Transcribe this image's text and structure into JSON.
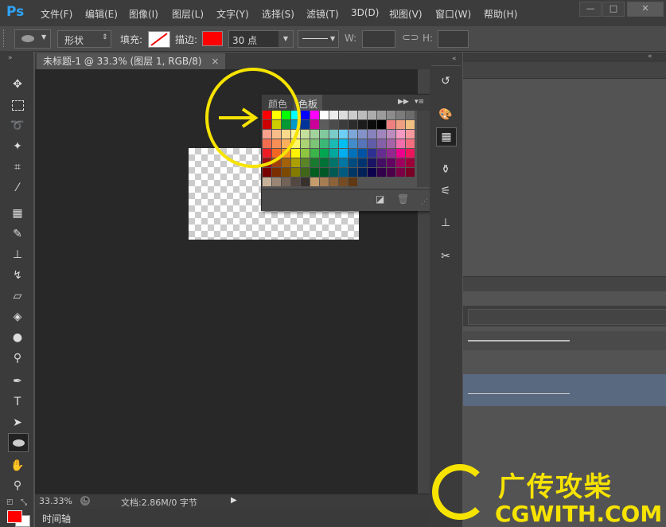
{
  "app": {
    "logo": "Ps"
  },
  "menu": [
    "文件(F)",
    "编辑(E)",
    "图像(I)",
    "图层(L)",
    "文字(Y)",
    "选择(S)",
    "滤镜(T)",
    "3D(D)",
    "视图(V)",
    "窗口(W)",
    "帮助(H)"
  ],
  "window_controls": {
    "minimize": "—",
    "restore": "□",
    "close": "✕"
  },
  "options": {
    "shape_mode": "形状",
    "fill_label": "填充:",
    "stroke_label": "描边:",
    "stroke_color": "#ff0000",
    "stroke_width": "30 点",
    "w_label": "W:",
    "h_label": "H:"
  },
  "document": {
    "tab_title": "未标题-1 @ 33.3% (图层 1, RGB/8)",
    "tab_close": "×",
    "zoom": "33.33%",
    "doc_info": "文档:2.86M/0 字节",
    "timeline_label": "时间轴"
  },
  "swatches_panel": {
    "tab_color": "颜色",
    "tab_swatches": "色板",
    "rows": [
      [
        "#ff0000",
        "#ffff00",
        "#00ff00",
        "#00ffff",
        "#0000ff",
        "#ff00ff",
        "#ffffff",
        "#ececec",
        "#dcdcdc",
        "#cccccc",
        "#bcbcbc",
        "#acacac",
        "#9c9c9c",
        "#8c8c8c",
        "#7c7c7c",
        "#6c6c6c"
      ],
      [
        "#cc0000",
        "#cccc00",
        "#009933",
        "#0099cc",
        "#003399",
        "#cc0099",
        "#5c5c5c",
        "#4c4c4c",
        "#3c3c3c",
        "#2c2c2c",
        "#1c1c1c",
        "#0c0c0c",
        "#000000",
        "#f08080",
        "#f0a080",
        "#f0c080"
      ],
      [
        "#f7a08c",
        "#f9bd8a",
        "#fbd98a",
        "#fff49a",
        "#c4df9b",
        "#a3d39c",
        "#82ca9d",
        "#7accc8",
        "#6dcff6",
        "#7da7d9",
        "#8393ca",
        "#8781bd",
        "#a186be",
        "#bd8cbf",
        "#f49ac2",
        "#f6989d"
      ],
      [
        "#f26c4f",
        "#f68e55",
        "#fbaf5d",
        "#fff568",
        "#acd372",
        "#7cc576",
        "#3bb878",
        "#1abbb4",
        "#00bff3",
        "#438ccb",
        "#5574b9",
        "#605ca8",
        "#855fa8",
        "#a763a8",
        "#f06eaa",
        "#f26d7d"
      ],
      [
        "#ed1c24",
        "#f26522",
        "#f7941d",
        "#fff200",
        "#8dc63f",
        "#39b54a",
        "#00a651",
        "#00a99d",
        "#00aeef",
        "#0072bc",
        "#0054a6",
        "#2e3192",
        "#662d91",
        "#92278f",
        "#ec008c",
        "#ed145b"
      ],
      [
        "#9e0b0f",
        "#a0410d",
        "#a36209",
        "#aba000",
        "#598527",
        "#1a7b30",
        "#007236",
        "#00746b",
        "#0076a3",
        "#004b80",
        "#003471",
        "#1b1464",
        "#440e62",
        "#630460",
        "#9e005d",
        "#9e0039"
      ],
      [
        "#790000",
        "#7b2e00",
        "#7d4900",
        "#827b00",
        "#406618",
        "#005e20",
        "#005826",
        "#005952",
        "#005b7f",
        "#003663",
        "#002157",
        "#0d004c",
        "#32004b",
        "#4b0049",
        "#7b0046",
        "#7a0026"
      ],
      [
        "#c7b299",
        "#998675",
        "#736357",
        "#534741",
        "#37302d",
        "#c69c6d",
        "#a67c52",
        "#8c6239",
        "#754c24",
        "#603913"
      ]
    ]
  },
  "dock": {
    "icons": [
      "history-icon",
      "color-icon",
      "swatches-icon",
      "brush-icon",
      "brush-presets-icon",
      "clone-source-icon",
      "tool-presets-icon"
    ]
  },
  "watermark": {
    "line1": "广传攻柴",
    "line2": "CGWITH.COM"
  },
  "annotation": {
    "color": "#f6e300"
  },
  "colors": {
    "foreground": "#ff0000",
    "background": "#ffffff"
  }
}
